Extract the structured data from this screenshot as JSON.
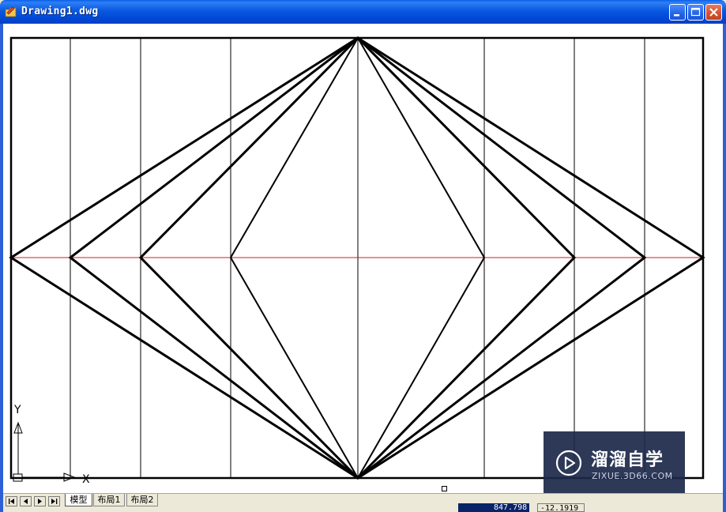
{
  "window": {
    "title": "Drawing1.dwg",
    "buttons": {
      "minimize": "minimize",
      "maximize": "maximize",
      "close": "close"
    }
  },
  "ucs": {
    "y_label": "Y",
    "x_label": "X"
  },
  "tabs": {
    "nav": [
      "first",
      "prev",
      "next",
      "last"
    ],
    "items": [
      {
        "label": "模型",
        "active": true
      },
      {
        "label": "布局1",
        "active": false
      },
      {
        "label": "布局2",
        "active": false
      }
    ]
  },
  "status": {
    "coord_x": "847.798",
    "coord_y": "-12.1919"
  },
  "watermark": {
    "title": "溜溜自学",
    "subtitle": "ZIXUE.3D66.COM"
  },
  "colors": {
    "accent_line": "#d21e1e",
    "title_bar": "#0a58e0",
    "drawing_line": "#000000"
  }
}
